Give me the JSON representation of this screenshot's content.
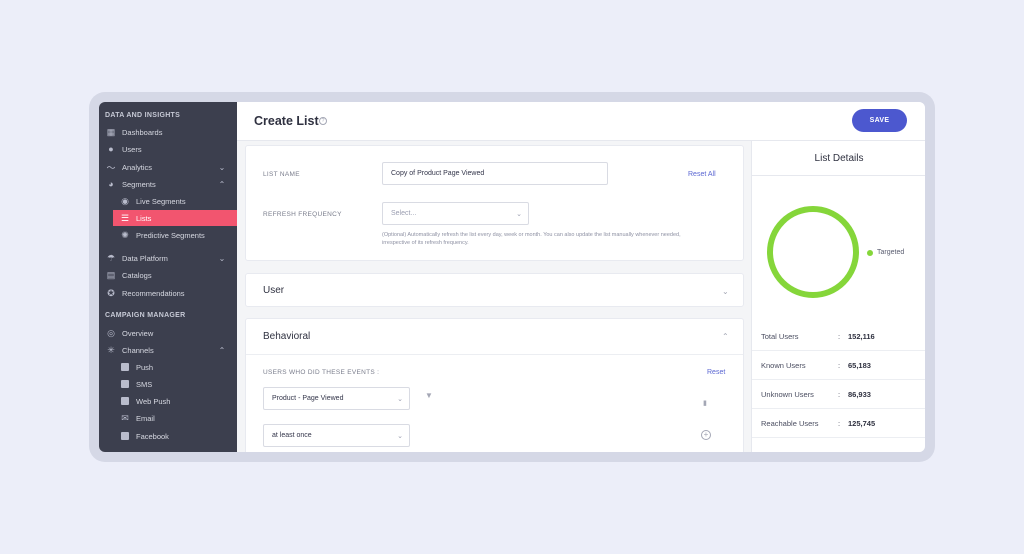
{
  "sidebar": {
    "section_data": "DATA AND INSIGHTS",
    "section_campaign": "CAMPAIGN MANAGER",
    "items": {
      "dashboards": "Dashboards",
      "users": "Users",
      "analytics": "Analytics",
      "segments": "Segments",
      "live_segments": "Live Segments",
      "lists": "Lists",
      "predictive_segments": "Predictive Segments",
      "data_platform": "Data Platform",
      "catalogs": "Catalogs",
      "recommendations": "Recommendations",
      "overview": "Overview",
      "channels": "Channels",
      "push": "Push",
      "sms": "SMS",
      "web_push": "Web Push",
      "email": "Email",
      "facebook": "Facebook"
    },
    "active_color": "#f2556f"
  },
  "header": {
    "title": "Create List",
    "save_label": "SAVE"
  },
  "form": {
    "list_name_label": "LIST NAME",
    "list_name_value": "Copy of Product Page Viewed",
    "reset_all": "Reset All",
    "refresh_label": "REFRESH FREQUENCY",
    "refresh_placeholder": "Select...",
    "refresh_hint": "(Optional) Automatically refresh the list every day, week or month. You can also update the list manually whenever needed, irrespective of its refresh frequency."
  },
  "sections": {
    "user": "User",
    "behavioral": "Behavioral",
    "events_label": "USERS WHO DID THESE EVENTS :",
    "reset": "Reset",
    "event_value": "Product - Page Viewed",
    "frequency_value": "at least once"
  },
  "details": {
    "title": "List Details",
    "legend": "Targeted",
    "targeted_color": "#85d63a",
    "targeted_fraction": 1.0,
    "stats": [
      {
        "label": "Total Users",
        "value": "152,116"
      },
      {
        "label": "Known Users",
        "value": "65,183"
      },
      {
        "label": "Unknown Users",
        "value": "86,933"
      },
      {
        "label": "Reachable Users",
        "value": "125,745"
      }
    ]
  }
}
